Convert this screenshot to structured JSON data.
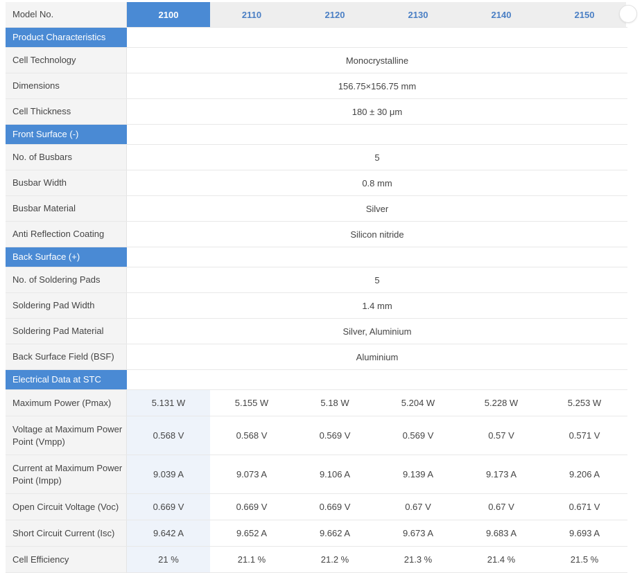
{
  "header": {
    "label": "Model No.",
    "models": [
      "2100",
      "2110",
      "2120",
      "2130",
      "2140",
      "2150"
    ],
    "active_index": 0
  },
  "sections": [
    {
      "title": "Product Characteristics",
      "rows": [
        {
          "label": "Cell Technology",
          "value": "Monocrystalline"
        },
        {
          "label": "Dimensions",
          "value": "156.75×156.75 mm"
        },
        {
          "label": "Cell Thickness",
          "value": "180 ± 30 μm"
        }
      ]
    },
    {
      "title": "Front Surface (-)",
      "rows": [
        {
          "label": "No. of Busbars",
          "value": "5"
        },
        {
          "label": "Busbar Width",
          "value": "0.8 mm"
        },
        {
          "label": "Busbar Material",
          "value": "Silver"
        },
        {
          "label": "Anti Reflection Coating",
          "value": "Silicon nitride"
        }
      ]
    },
    {
      "title": "Back Surface (+)",
      "rows": [
        {
          "label": "No. of Soldering Pads",
          "value": "5"
        },
        {
          "label": "Soldering Pad Width",
          "value": "1.4 mm"
        },
        {
          "label": "Soldering Pad Material",
          "value": "Silver, Aluminium"
        },
        {
          "label": "Back Surface Field (BSF)",
          "value": "Aluminium"
        }
      ]
    },
    {
      "title": "Electrical Data at STC",
      "rows": [
        {
          "label": "Maximum Power (Pmax)",
          "values": [
            "5.131 W",
            "5.155 W",
            "5.18 W",
            "5.204 W",
            "5.228 W",
            "5.253 W"
          ]
        },
        {
          "label": "Voltage at Maximum Power Point (Vmpp)",
          "values": [
            "0.568 V",
            "0.568 V",
            "0.569 V",
            "0.569 V",
            "0.57 V",
            "0.571 V"
          ]
        },
        {
          "label": "Current at Maximum Power Point (Impp)",
          "values": [
            "9.039 A",
            "9.073 A",
            "9.106 A",
            "9.139 A",
            "9.173 A",
            "9.206 A"
          ]
        },
        {
          "label": "Open Circuit Voltage (Voc)",
          "values": [
            "0.669 V",
            "0.669 V",
            "0.669 V",
            "0.67 V",
            "0.67 V",
            "0.671 V"
          ]
        },
        {
          "label": "Short Circuit Current (Isc)",
          "values": [
            "9.642 A",
            "9.652 A",
            "9.662 A",
            "9.673 A",
            "9.683 A",
            "9.693 A"
          ]
        },
        {
          "label": "Cell Efficiency",
          "values": [
            "21 %",
            "21.1 %",
            "21.2 %",
            "21.3 %",
            "21.4 %",
            "21.5 %"
          ]
        }
      ]
    }
  ]
}
